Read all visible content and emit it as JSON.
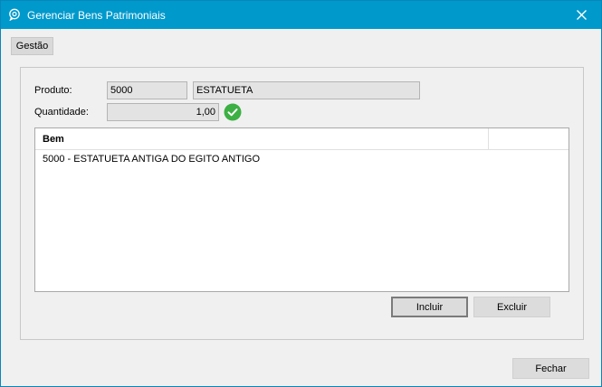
{
  "window": {
    "title": "Gerenciar Bens Patrimoniais",
    "close_symbol": "✕"
  },
  "tabs": [
    {
      "label": "Gestão"
    }
  ],
  "form": {
    "produto_label": "Produto:",
    "produto_code": "5000",
    "produto_name": "ESTATUETA",
    "quantidade_label": "Quantidade:",
    "quantidade_value": "1,00"
  },
  "grid": {
    "columns": [
      "Bem",
      ""
    ],
    "rows": [
      {
        "bem": "5000 - ESTATUETA ANTIGA DO EGITO ANTIGO"
      }
    ]
  },
  "buttons": {
    "incluir": "Incluir",
    "excluir": "Excluir",
    "fechar": "Fechar"
  },
  "colors": {
    "titlebar": "#0099cc",
    "check": "#3cb043"
  },
  "icons": {
    "app": "chat-bubble-icon",
    "close": "close-icon",
    "valid": "checkmark-circle-icon"
  }
}
